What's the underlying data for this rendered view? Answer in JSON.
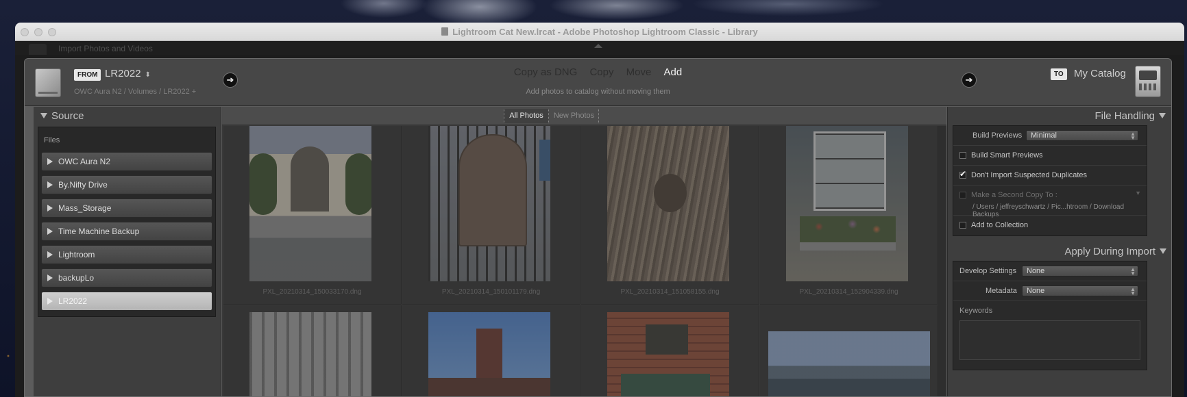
{
  "window": {
    "title": "Lightroom Cat New.lrcat - Adobe Photoshop Lightroom Classic - Library",
    "behind_text": "Import Photos and Videos"
  },
  "from": {
    "badge": "FROM",
    "source": "LR2022",
    "stepper": "⬍",
    "path": "OWC Aura N2 / Volumes / LR2022 +"
  },
  "modes": {
    "items": [
      "Copy as DNG",
      "Copy",
      "Move",
      "Add"
    ],
    "active": "Add",
    "description": "Add photos to catalog without moving them"
  },
  "to": {
    "badge": "TO",
    "label": "My Catalog"
  },
  "source_panel": {
    "title": "Source",
    "files_label": "Files",
    "items": [
      "OWC Aura N2",
      "By.Nifty Drive",
      "Mass_Storage",
      "Time Machine Backup",
      "Lightroom",
      "backupLo",
      "LR2022"
    ],
    "selected": "LR2022"
  },
  "grid": {
    "tabs": [
      "All Photos",
      "New Photos"
    ],
    "active_tab": "All Photos",
    "photos": [
      {
        "name": "PXL_20210314_150033170.dng"
      },
      {
        "name": "PXL_20210314_150101179.dng"
      },
      {
        "name": "PXL_20210314_151058155.dng"
      },
      {
        "name": "PXL_20210314_152904339.dng"
      }
    ]
  },
  "file_handling": {
    "title": "File Handling",
    "build_previews_label": "Build Previews",
    "build_previews_value": "Minimal",
    "build_smart_previews": "Build Smart Previews",
    "build_smart_previews_checked": false,
    "no_duplicates": "Don't Import Suspected Duplicates",
    "no_duplicates_checked": true,
    "second_copy": "Make a Second Copy To :",
    "second_copy_checked": false,
    "second_copy_path": "/ Users / jeffreyschwartz / Pic...htroom / Download Backups",
    "add_to_collection": "Add to Collection",
    "add_to_collection_checked": false
  },
  "apply_during_import": {
    "title": "Apply During Import",
    "develop_label": "Develop Settings",
    "develop_value": "None",
    "metadata_label": "Metadata",
    "metadata_value": "None",
    "keywords_label": "Keywords"
  }
}
